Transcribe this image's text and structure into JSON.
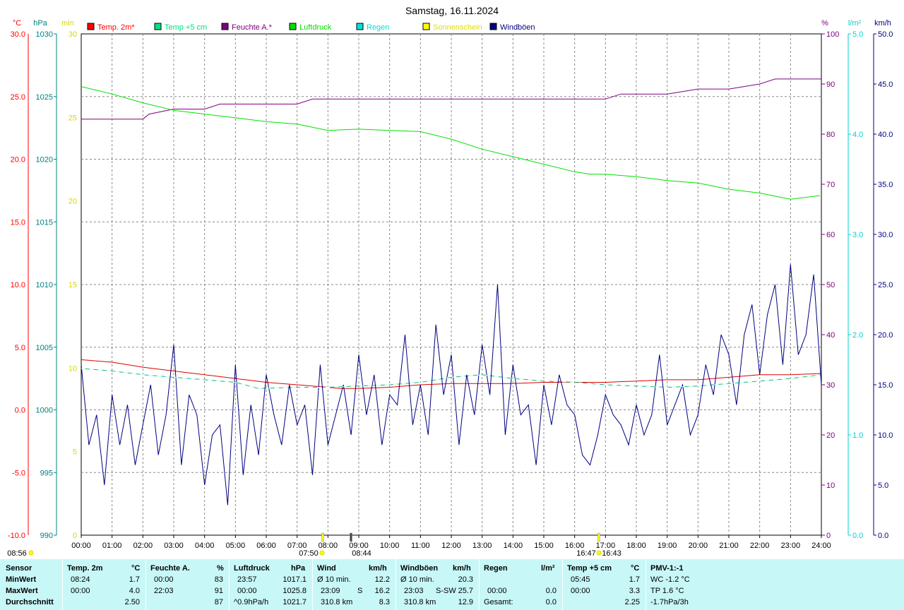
{
  "chart_data": {
    "type": "line",
    "title": "Samstag, 16.11.2024",
    "x_ticks": [
      "00:00",
      "01:00",
      "02:00",
      "03:00",
      "04:00",
      "05:00",
      "06:00",
      "07:00",
      "08:00",
      "09:00",
      "10:00",
      "11:00",
      "12:00",
      "13:00",
      "14:00",
      "15:00",
      "16:00",
      "17:00",
      "18:00",
      "19:00",
      "20:00",
      "21:00",
      "22:00",
      "23:00",
      "24:00"
    ],
    "x_range_hours": [
      0,
      24
    ],
    "grid": true,
    "axes": {
      "temp": {
        "unit": "°C",
        "range": [
          -10,
          30
        ],
        "ticks": [
          "30.0",
          "25.0",
          "20.0",
          "15.0",
          "10.0",
          "5.0",
          "0.0",
          "-5.0",
          "-10.0"
        ],
        "color": "#ff0000"
      },
      "pressure": {
        "unit": "hPa",
        "range": [
          990,
          1030
        ],
        "ticks": [
          "1030",
          "1025",
          "1020",
          "1015",
          "1010",
          "1005",
          "1000",
          "995",
          "990"
        ],
        "color": "#008080"
      },
      "sunshine": {
        "unit": "min",
        "range": [
          0,
          30
        ],
        "ticks": [
          "30",
          "25",
          "20",
          "15",
          "10",
          "5",
          "0"
        ],
        "color": "#e0e000"
      },
      "humidity": {
        "unit": "%",
        "range": [
          0,
          100
        ],
        "ticks": [
          "100",
          "90",
          "80",
          "70",
          "60",
          "50",
          "40",
          "30",
          "20",
          "10",
          "0"
        ],
        "color": "#800080"
      },
      "rain": {
        "unit": "l/m²",
        "range": [
          0,
          5
        ],
        "ticks": [
          "5.0",
          "4.0",
          "3.0",
          "2.0",
          "1.0",
          "0.0"
        ],
        "color": "#00d0d0"
      },
      "wind": {
        "unit": "km/h",
        "range": [
          0,
          50
        ],
        "ticks": [
          "50.0",
          "45.0",
          "40.0",
          "35.0",
          "30.0",
          "25.0",
          "20.0",
          "15.0",
          "10.0",
          "5.0",
          "0.0"
        ],
        "color": "#000080"
      }
    },
    "legend": [
      {
        "name": "Temp. 2m*",
        "color": "#ff0000"
      },
      {
        "name": "Temp +5 cm",
        "color": "#00e080"
      },
      {
        "name": "Feuchte A.*",
        "color": "#800080"
      },
      {
        "name": "Luftdruck",
        "color": "#00e000"
      },
      {
        "name": "Regen",
        "color": "#00e0e0"
      },
      {
        "name": "Sonnenschein",
        "color": "#ffff00"
      },
      {
        "name": "Windböen",
        "color": "#000080"
      }
    ],
    "series": [
      {
        "name": "Temp. 2m*",
        "axis": "temp",
        "color": "#e00000",
        "x": [
          0,
          1,
          2,
          3,
          4,
          5,
          6,
          7,
          8,
          8.4,
          9,
          10,
          11,
          12,
          13,
          14,
          15,
          16,
          17,
          18,
          19,
          20,
          21,
          22,
          23,
          24
        ],
        "y": [
          4.0,
          3.8,
          3.4,
          3.1,
          2.8,
          2.5,
          2.2,
          2.0,
          1.8,
          1.7,
          1.7,
          1.8,
          2.0,
          2.1,
          2.1,
          2.1,
          2.2,
          2.2,
          2.2,
          2.3,
          2.4,
          2.4,
          2.6,
          2.8,
          2.8,
          2.9
        ]
      },
      {
        "name": "Temp +5 cm",
        "axis": "temp",
        "color": "#00c080",
        "x": [
          0,
          1,
          2,
          3,
          4,
          5,
          5.75,
          7,
          8,
          9,
          10,
          11,
          12,
          13,
          14,
          15,
          16,
          17,
          18,
          19,
          20,
          21,
          22,
          23,
          24
        ],
        "y": [
          3.3,
          3.1,
          2.8,
          2.6,
          2.4,
          2.2,
          1.7,
          1.8,
          1.8,
          1.9,
          2.0,
          2.2,
          2.6,
          2.8,
          2.5,
          2.3,
          2.2,
          2.0,
          1.9,
          1.8,
          1.9,
          2.1,
          2.3,
          2.5,
          2.8
        ]
      },
      {
        "name": "Feuchte A.*",
        "axis": "humidity",
        "color": "#800080",
        "x": [
          0,
          1,
          2,
          2.2,
          3,
          3.5,
          4,
          4.5,
          5,
          6,
          7,
          7.5,
          8,
          8.5,
          9,
          10,
          11,
          12,
          13,
          14,
          15,
          16,
          17,
          17.5,
          18,
          18.5,
          19,
          20,
          21,
          22,
          22.5,
          23,
          24
        ],
        "y": [
          83,
          83,
          83,
          84,
          85,
          85,
          85,
          86,
          86,
          86,
          86,
          87,
          87,
          87,
          87,
          87,
          87,
          87,
          87,
          87,
          87,
          87,
          87,
          88,
          88,
          88,
          88,
          89,
          89,
          90,
          91,
          91,
          91
        ]
      },
      {
        "name": "Luftdruck",
        "axis": "pressure",
        "color": "#00e000",
        "x": [
          0,
          1,
          2,
          3,
          4,
          5,
          6,
          7,
          8,
          9,
          10,
          11,
          12,
          13,
          14,
          15,
          16,
          16.5,
          17,
          18,
          19,
          20,
          21,
          22,
          23,
          23.95
        ],
        "y": [
          1025.8,
          1025.2,
          1024.5,
          1023.9,
          1023.6,
          1023.3,
          1023.0,
          1022.8,
          1022.3,
          1022.4,
          1022.3,
          1022.2,
          1021.6,
          1020.8,
          1020.2,
          1019.6,
          1019.0,
          1018.8,
          1018.8,
          1018.6,
          1018.3,
          1018.1,
          1017.6,
          1017.3,
          1016.8,
          1017.1
        ]
      },
      {
        "name": "Windböen",
        "axis": "wind",
        "color": "#000080",
        "x": [
          0,
          0.25,
          0.5,
          0.75,
          1,
          1.25,
          1.5,
          1.75,
          2,
          2.25,
          2.5,
          2.75,
          3,
          3.25,
          3.5,
          3.75,
          4,
          4.25,
          4.5,
          4.75,
          5,
          5.25,
          5.5,
          5.75,
          6,
          6.25,
          6.5,
          6.75,
          7,
          7.25,
          7.5,
          7.75,
          8,
          8.25,
          8.5,
          8.75,
          9,
          9.25,
          9.5,
          9.75,
          10,
          10.25,
          10.5,
          10.75,
          11,
          11.25,
          11.5,
          11.75,
          12,
          12.25,
          12.5,
          12.75,
          13,
          13.25,
          13.5,
          13.75,
          14,
          14.25,
          14.5,
          14.75,
          15,
          15.25,
          15.5,
          15.75,
          16,
          16.25,
          16.5,
          16.75,
          17,
          17.25,
          17.5,
          17.75,
          18,
          18.25,
          18.5,
          18.75,
          19,
          19.25,
          19.5,
          19.75,
          20,
          20.25,
          20.5,
          20.75,
          21,
          21.25,
          21.5,
          21.75,
          22,
          22.25,
          22.5,
          22.75,
          23,
          23.25,
          23.5,
          23.75,
          24
        ],
        "y": [
          17,
          9,
          12,
          5,
          14,
          9,
          13,
          7,
          11,
          15,
          8,
          12,
          19,
          7,
          14,
          12,
          5,
          10,
          11,
          3,
          17,
          6,
          13,
          8,
          16,
          12,
          9,
          15,
          11,
          13,
          6,
          17,
          9,
          12,
          15,
          10,
          18,
          12,
          16,
          9,
          14,
          13,
          20,
          11,
          15,
          10,
          21,
          14,
          18,
          9,
          16,
          12,
          19,
          14,
          25,
          10,
          17,
          12,
          13,
          7,
          15,
          11,
          16,
          13,
          12,
          8,
          7,
          10,
          14,
          12,
          11,
          9,
          13,
          10,
          12,
          18,
          11,
          13,
          15,
          10,
          12,
          17,
          14,
          20,
          18,
          13,
          20,
          23,
          16,
          22,
          25,
          17,
          27,
          18,
          20,
          26,
          15
        ]
      }
    ],
    "markers": [
      {
        "label": "08:56",
        "axis_note": "sunrise-left"
      },
      {
        "label": "07:50"
      },
      {
        "label": "08:44"
      },
      {
        "label": "16:47"
      },
      {
        "label": "16:43"
      }
    ]
  },
  "summary": {
    "headers": {
      "sensor": "Sensor",
      "temp": "Temp. 2m",
      "temp_unit": "°C",
      "hum": "Feuchte A.",
      "hum_unit": "%",
      "press": "Luftdruck",
      "press_unit": "hPa",
      "wind": "Wind",
      "wind_unit": "km/h",
      "gust": "Windböen",
      "gust_unit": "km/h",
      "rain": "Regen",
      "rain_unit": "l/m²",
      "temp5": "Temp +5 cm",
      "temp5_unit": "°C",
      "pmv": "PMV-1:-1"
    },
    "rows": {
      "min_label": "MinWert",
      "max_label": "MaxWert",
      "avg_label": "Durchschnitt"
    },
    "temp": {
      "min_time": "08:24",
      "min": "1.7",
      "max_time": "00:00",
      "max": "4.0",
      "avg": "2.50"
    },
    "hum": {
      "min_time": "00:00",
      "min": "83",
      "max_time": "22:03",
      "max": "91",
      "avg": "87"
    },
    "press": {
      "min_time": "23:57",
      "min": "1017.1",
      "max_time": "00:00",
      "max": "1025.8",
      "trend": "^0.9hPa/h",
      "avg": "1021.7"
    },
    "wind": {
      "min_label": "Ø 10 min.",
      "min": "12.2",
      "max_time": "23:09",
      "max_dir": "S",
      "max": "16.2",
      "dist": "310.8 km",
      "avg": "8.3"
    },
    "gust": {
      "min_label": "Ø 10 min.",
      "min": "20.3",
      "max_time": "23:03",
      "max_dir": "S-SW",
      "max": "25.7",
      "dist": "310.8 km",
      "avg": "12.9"
    },
    "rain": {
      "max_time": "00:00",
      "max": "0.0",
      "total_label": "Gesamt:",
      "total": "0.0"
    },
    "temp5": {
      "min_time": "05:45",
      "min": "1.7",
      "max_time": "00:00",
      "max": "3.3",
      "avg": "2.25"
    },
    "pmv": {
      "wc": "WC -1.2 °C",
      "tp": "TP 1.6 °C",
      "trend": "-1.7hPa/3h"
    }
  }
}
